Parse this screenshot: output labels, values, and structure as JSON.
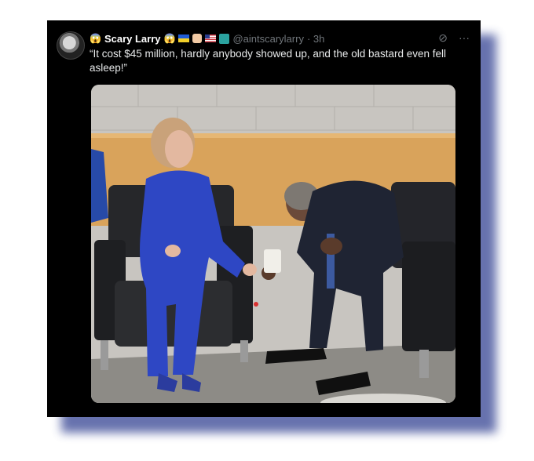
{
  "post": {
    "display_name": "Scary Larry",
    "handle": "@aintscarylarry",
    "time": "· 3h",
    "text": "“It cost $45 million, hardly anybody showed up, and the old bastard even fell asleep!”",
    "emoji_left": "😱",
    "emoji_right": "😱",
    "more_glyph": "···",
    "grok_glyph": "⊘"
  },
  "colors": {
    "card_bg": "#000000",
    "handle": "#71767b",
    "frame_shadow": "#4d5aa0"
  }
}
